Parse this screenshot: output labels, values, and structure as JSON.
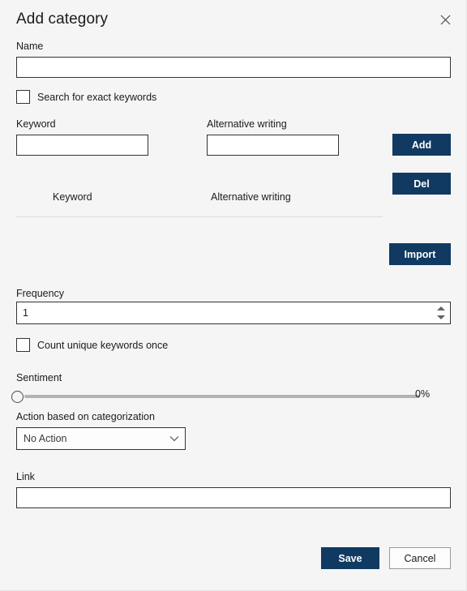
{
  "dialog": {
    "title": "Add category",
    "close_icon": "close-icon"
  },
  "name_section": {
    "label": "Name",
    "value": "",
    "placeholder": ""
  },
  "exact_keywords": {
    "label": "Search for exact keywords",
    "checked": false
  },
  "keyword_entry": {
    "keyword_label": "Keyword",
    "keyword_value": "",
    "alternative_label": "Alternative writing",
    "alternative_value": "",
    "add_label": "Add",
    "del_label": "Del"
  },
  "keyword_table": {
    "columns": [
      "Keyword",
      "Alternative writing"
    ],
    "rows": []
  },
  "import": {
    "label": "Import"
  },
  "frequency": {
    "label": "Frequency",
    "value": "1",
    "spinner_up_icon": "chevron-up-icon",
    "spinner_down_icon": "chevron-down-icon"
  },
  "count_unique": {
    "label": "Count unique keywords once",
    "checked": false
  },
  "sentiment": {
    "label": "Sentiment",
    "value_text": "0%",
    "value": 0,
    "min": 0,
    "max": 100
  },
  "action": {
    "label": "Action based on categorization",
    "selected": "No Action",
    "chevron_icon": "chevron-down-icon"
  },
  "link": {
    "label": "Link",
    "value": "",
    "placeholder": ""
  },
  "footer": {
    "save_label": "Save",
    "cancel_label": "Cancel"
  },
  "colors": {
    "primary": "#103a61",
    "background": "#f5f5f5",
    "field_border": "#333333",
    "divider": "#dcdcdc"
  }
}
